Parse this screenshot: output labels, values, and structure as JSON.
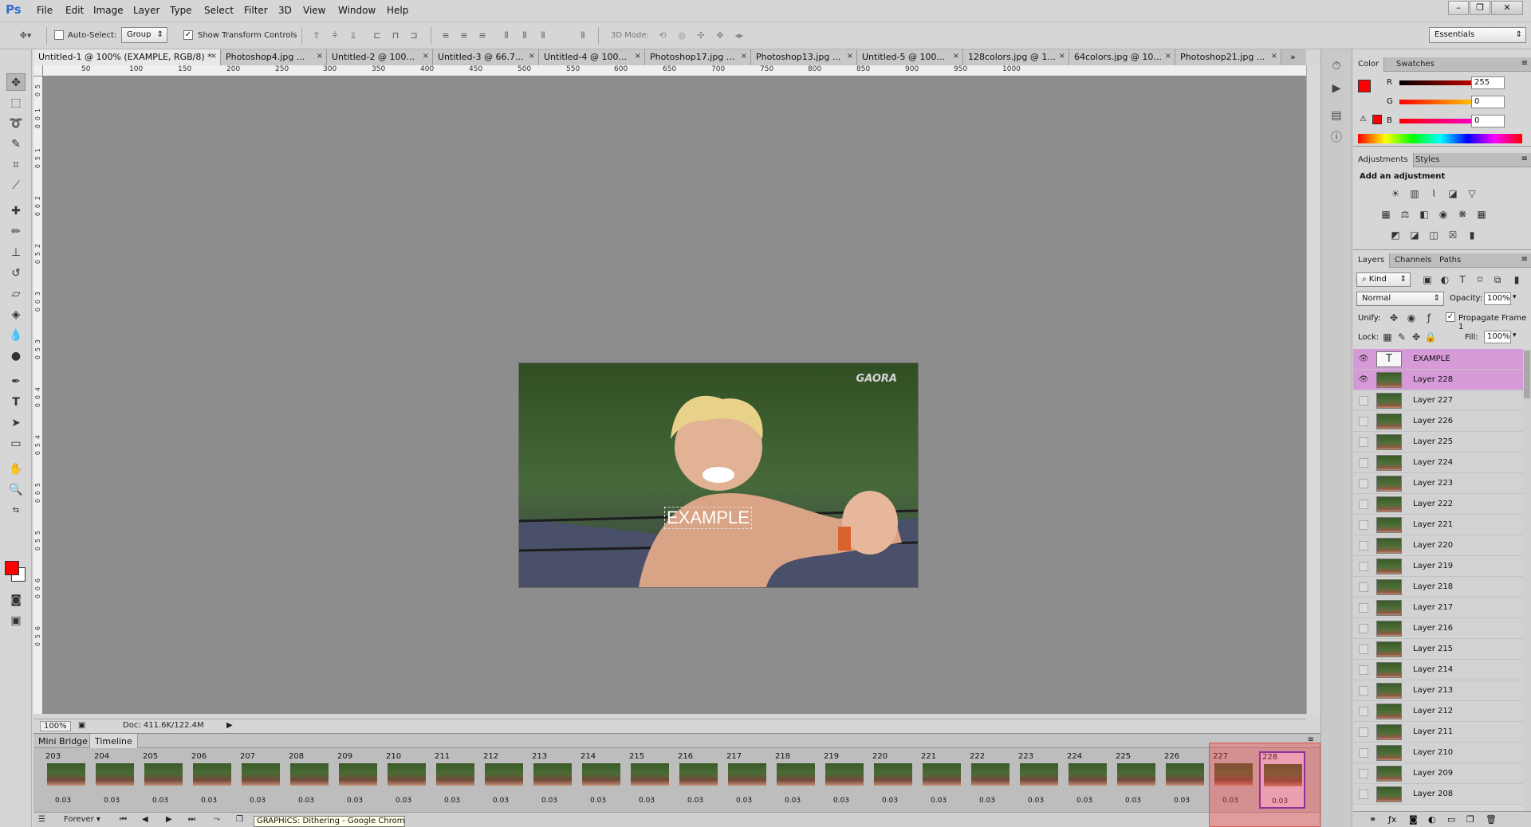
{
  "menubar": {
    "logo": "Ps",
    "items": [
      "File",
      "Edit",
      "Image",
      "Layer",
      "Type",
      "Select",
      "Filter",
      "3D",
      "View",
      "Window",
      "Help"
    ],
    "window_buttons": [
      "–",
      "❐",
      "✕"
    ]
  },
  "options_bar": {
    "auto_select_label": "Auto-Select:",
    "auto_select_value": "Group",
    "transform_label": "Show Transform Controls",
    "mode_3d_label": "3D Mode:",
    "workspace": "Essentials"
  },
  "doc_tabs": [
    "Untitled-1 @ 100% (EXAMPLE, RGB/8) *",
    "Photoshop4.jpg ...",
    "Untitled-2 @ 100...",
    "Untitled-3 @ 66.7...",
    "Untitled-4 @ 100...",
    "Photoshop17.jpg ...",
    "Photoshop13.jpg ...",
    "Untitled-5 @ 100...",
    "128colors.jpg @ 1...",
    "64colors.jpg @ 10...",
    "Photoshop21.jpg ..."
  ],
  "ruler_h": [
    "50",
    "100",
    "150",
    "200",
    "250",
    "300",
    "350",
    "400",
    "450",
    "500",
    "550",
    "600",
    "650",
    "700",
    "750",
    "800",
    "850",
    "900",
    "950",
    "1000"
  ],
  "ruler_v": [
    "5",
    "0",
    "1",
    "0",
    "0",
    "1",
    "5",
    "0",
    "2",
    "0",
    "0",
    "2",
    "5",
    "0",
    "3",
    "0",
    "0",
    "3",
    "5",
    "0",
    "4",
    "0",
    "0",
    "4",
    "5",
    "0",
    "5",
    "0",
    "0",
    "5",
    "5",
    "0",
    "6",
    "0",
    "0",
    "6",
    "5",
    "0"
  ],
  "canvas": {
    "overlay_text": "EXAMPLE",
    "watermark": "GAORA"
  },
  "status_bar": {
    "zoom": "100%",
    "doc_info": "Doc: 411.6K/122.4M"
  },
  "timeline": {
    "tabs": [
      "Mini Bridge",
      "Timeline"
    ],
    "frames": [
      {
        "num": "203",
        "delay": "0.03"
      },
      {
        "num": "204",
        "delay": "0.03"
      },
      {
        "num": "205",
        "delay": "0.03"
      },
      {
        "num": "206",
        "delay": "0.03"
      },
      {
        "num": "207",
        "delay": "0.03"
      },
      {
        "num": "208",
        "delay": "0.03"
      },
      {
        "num": "209",
        "delay": "0.03"
      },
      {
        "num": "210",
        "delay": "0.03"
      },
      {
        "num": "211",
        "delay": "0.03"
      },
      {
        "num": "212",
        "delay": "0.03"
      },
      {
        "num": "213",
        "delay": "0.03"
      },
      {
        "num": "214",
        "delay": "0.03"
      },
      {
        "num": "215",
        "delay": "0.03"
      },
      {
        "num": "216",
        "delay": "0.03"
      },
      {
        "num": "217",
        "delay": "0.03"
      },
      {
        "num": "218",
        "delay": "0.03"
      },
      {
        "num": "219",
        "delay": "0.03"
      },
      {
        "num": "220",
        "delay": "0.03"
      },
      {
        "num": "221",
        "delay": "0.03"
      },
      {
        "num": "222",
        "delay": "0.03"
      },
      {
        "num": "223",
        "delay": "0.03"
      },
      {
        "num": "224",
        "delay": "0.03"
      },
      {
        "num": "225",
        "delay": "0.03"
      },
      {
        "num": "226",
        "delay": "0.03"
      },
      {
        "num": "227",
        "delay": "0.03"
      },
      {
        "num": "228",
        "delay": "0.03"
      }
    ],
    "loop": "Forever",
    "tooltip": "GRAPHICS: Dithering - Google Chrome"
  },
  "color_panel": {
    "tabs": [
      "Color",
      "Swatches"
    ],
    "r_label": "R",
    "g_label": "G",
    "b_label": "B",
    "r": "255",
    "g": "0",
    "b": "0",
    "fg_color": "#ff0000"
  },
  "adjustments_panel": {
    "tabs": [
      "Adjustments",
      "Styles"
    ],
    "heading": "Add an adjustment"
  },
  "layers_panel": {
    "tabs": [
      "Layers",
      "Channels",
      "Paths"
    ],
    "filter_kind": "Kind",
    "blend_mode": "Normal",
    "opacity_label": "Opacity:",
    "opacity": "100%",
    "unify_label": "Unify:",
    "propagate_label": "Propagate Frame 1",
    "lock_label": "Lock:",
    "fill_label": "Fill:",
    "fill": "100%",
    "layers": [
      {
        "name": "EXAMPLE",
        "type": "text",
        "visible": true,
        "selected": true
      },
      {
        "name": "Layer 228",
        "type": "image",
        "visible": true,
        "selected": true
      },
      {
        "name": "Layer 227",
        "type": "image",
        "visible": false,
        "selected": false
      },
      {
        "name": "Layer 226",
        "type": "image",
        "visible": false,
        "selected": false
      },
      {
        "name": "Layer 225",
        "type": "image",
        "visible": false,
        "selected": false
      },
      {
        "name": "Layer 224",
        "type": "image",
        "visible": false,
        "selected": false
      },
      {
        "name": "Layer 223",
        "type": "image",
        "visible": false,
        "selected": false
      },
      {
        "name": "Layer 222",
        "type": "image",
        "visible": false,
        "selected": false
      },
      {
        "name": "Layer 221",
        "type": "image",
        "visible": false,
        "selected": false
      },
      {
        "name": "Layer 220",
        "type": "image",
        "visible": false,
        "selected": false
      },
      {
        "name": "Layer 219",
        "type": "image",
        "visible": false,
        "selected": false
      },
      {
        "name": "Layer 218",
        "type": "image",
        "visible": false,
        "selected": false
      },
      {
        "name": "Layer 217",
        "type": "image",
        "visible": false,
        "selected": false
      },
      {
        "name": "Layer 216",
        "type": "image",
        "visible": false,
        "selected": false
      },
      {
        "name": "Layer 215",
        "type": "image",
        "visible": false,
        "selected": false
      },
      {
        "name": "Layer 214",
        "type": "image",
        "visible": false,
        "selected": false
      },
      {
        "name": "Layer 213",
        "type": "image",
        "visible": false,
        "selected": false
      },
      {
        "name": "Layer 212",
        "type": "image",
        "visible": false,
        "selected": false
      },
      {
        "name": "Layer 211",
        "type": "image",
        "visible": false,
        "selected": false
      },
      {
        "name": "Layer 210",
        "type": "image",
        "visible": false,
        "selected": false
      },
      {
        "name": "Layer 209",
        "type": "image",
        "visible": false,
        "selected": false
      },
      {
        "name": "Layer 208",
        "type": "image",
        "visible": false,
        "selected": false
      }
    ]
  },
  "colors": {
    "accent_selected_layer": "#d79ad8",
    "selected_frame_border": "#5a2bd0",
    "ps_blue": "#2e6fd0"
  }
}
